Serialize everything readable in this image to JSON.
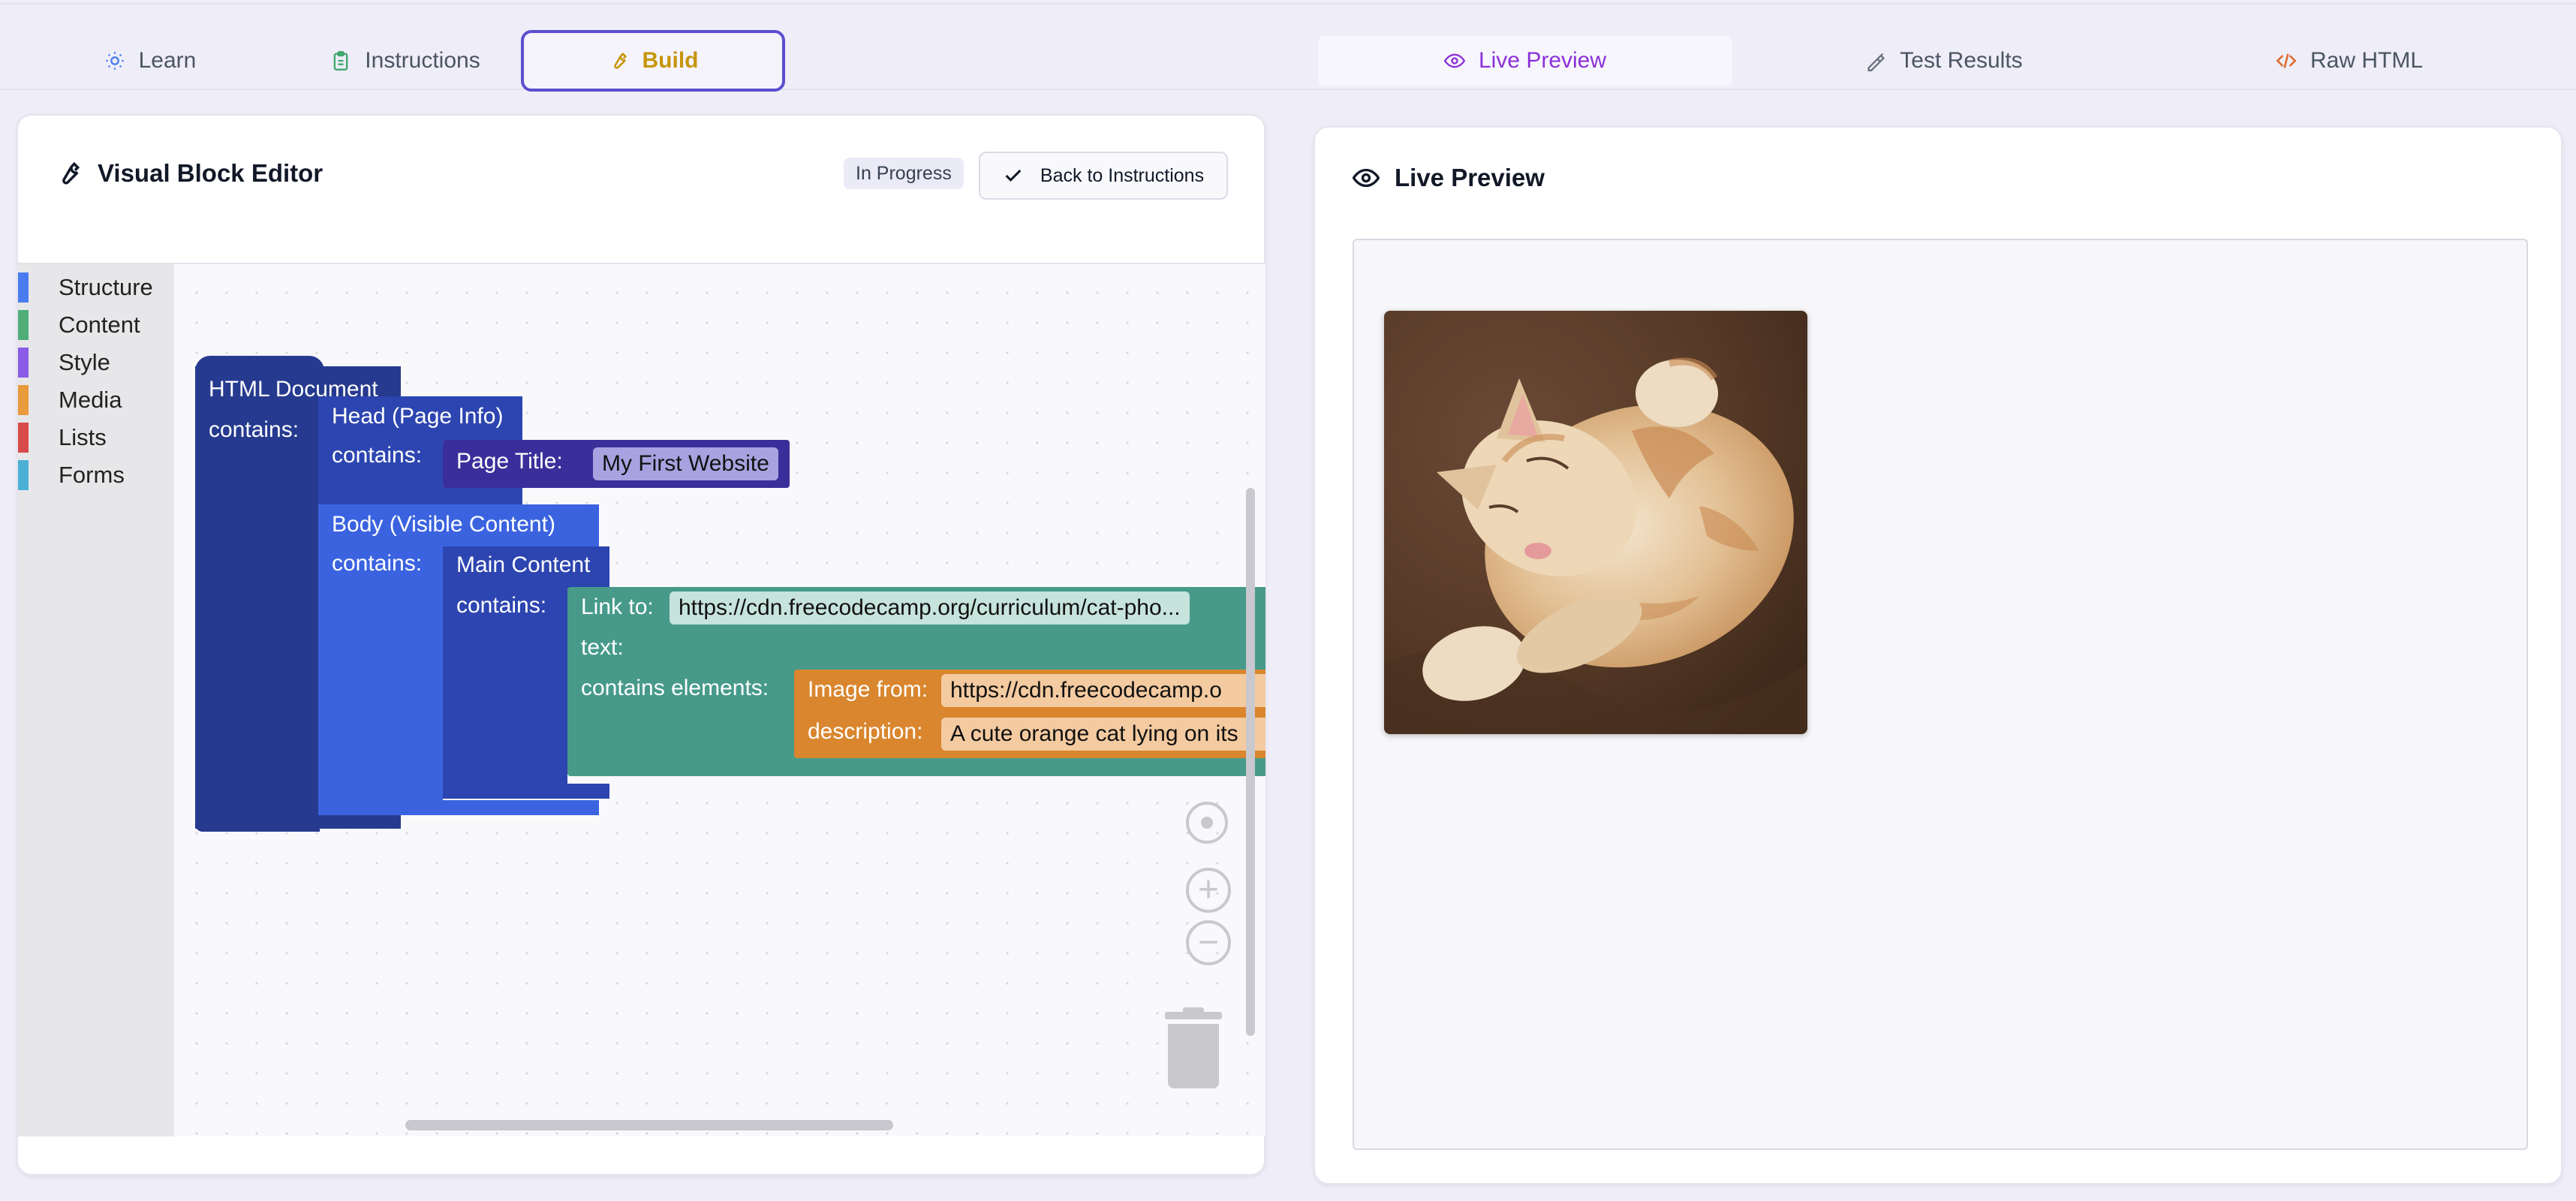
{
  "tabs": {
    "learn": "Learn",
    "instructions": "Instructions",
    "build": "Build",
    "live_preview": "Live Preview",
    "test_results": "Test Results",
    "raw_html": "Raw HTML"
  },
  "editor": {
    "title": "Visual Block Editor",
    "status_badge": "In Progress",
    "back_button": "Back to Instructions"
  },
  "toolbox": {
    "categories": [
      {
        "label": "Structure",
        "color": "#4a7cf0"
      },
      {
        "label": "Content",
        "color": "#4fae7a"
      },
      {
        "label": "Style",
        "color": "#8a5ce8"
      },
      {
        "label": "Media",
        "color": "#e99a3a"
      },
      {
        "label": "Lists",
        "color": "#d94a4a"
      },
      {
        "label": "Forms",
        "color": "#4ab0d6"
      }
    ]
  },
  "blocks": {
    "html_document": "HTML Document",
    "contains": "contains:",
    "head": "Head (Page Info)",
    "page_title_label": "Page Title:",
    "page_title_value": "My First Website",
    "body": "Body (Visible Content)",
    "main_content": "Main Content",
    "link_to_label": "Link to:",
    "link_url": "https://cdn.freecodecamp.org/curriculum/cat-pho...",
    "text_label": "text:",
    "contains_elements": "contains elements:",
    "image_from_label": "Image from:",
    "image_url": "https://cdn.freecodecamp.o",
    "description_label": "description:",
    "description_value": "A cute orange cat lying on its"
  },
  "preview": {
    "title": "Live Preview",
    "image_alt": "A cute orange cat lying on its back"
  },
  "colors": {
    "build_accent": "#c6950a",
    "preview_accent": "#8b30d9",
    "raw_html_accent": "#e06a2a",
    "block_document": "#263a8f",
    "block_body": "#3b63e0",
    "block_title": "#3a2f9a",
    "block_link": "#479a8a",
    "block_image": "#d9862e"
  }
}
